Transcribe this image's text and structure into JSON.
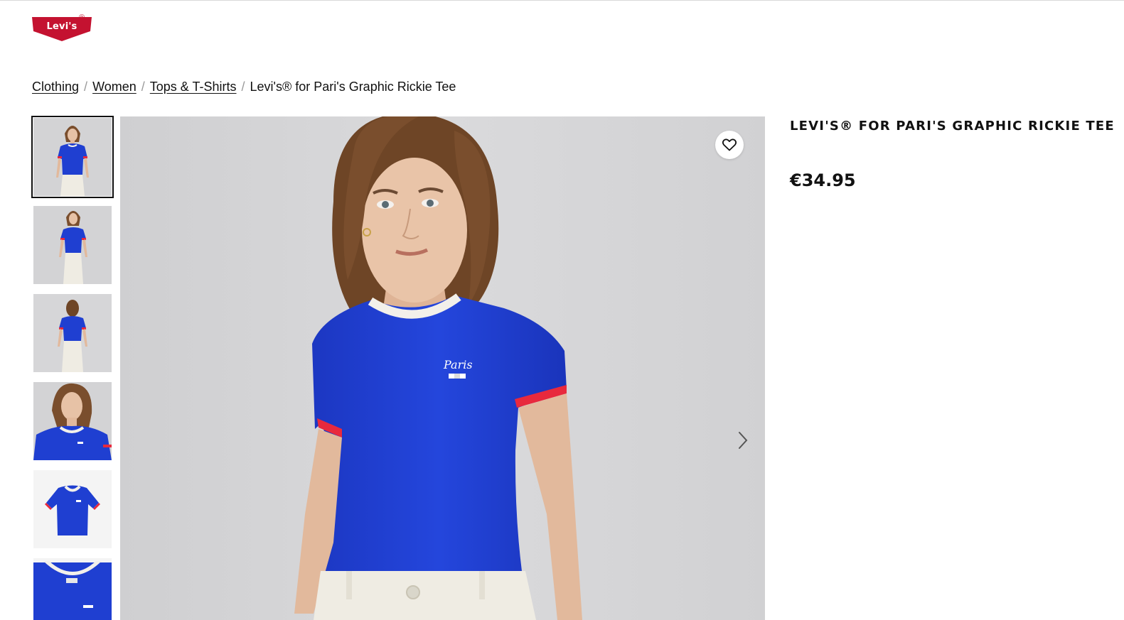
{
  "brand": {
    "logo_text": "Levi's",
    "logo_color": "#c41230",
    "registered_mark": "®"
  },
  "breadcrumb": {
    "items": [
      {
        "label": "Clothing"
      },
      {
        "label": "Women"
      },
      {
        "label": "Tops & T-Shirts"
      }
    ],
    "current": "Levi's® for Pari's Graphic Rickie Tee",
    "separator": "/"
  },
  "product": {
    "title": "Levi's® for Pari's Graphic Rickie Tee",
    "price": "€34.95"
  },
  "gallery": {
    "thumbnails": [
      {
        "view": "front-full",
        "active": true
      },
      {
        "view": "front-full-alt",
        "active": false
      },
      {
        "view": "back-full",
        "active": false
      },
      {
        "view": "closeup",
        "active": false
      },
      {
        "view": "flat-lay",
        "active": false
      },
      {
        "view": "collar-detail",
        "active": false
      }
    ],
    "favorite_icon": "heart-icon",
    "next_icon": "chevron-right-icon"
  },
  "colors": {
    "shirt_blue": "#1f3fd1",
    "trim_red": "#e8293d",
    "collar_white": "#f2f0ea",
    "background_gray": "#d4d4d6"
  }
}
